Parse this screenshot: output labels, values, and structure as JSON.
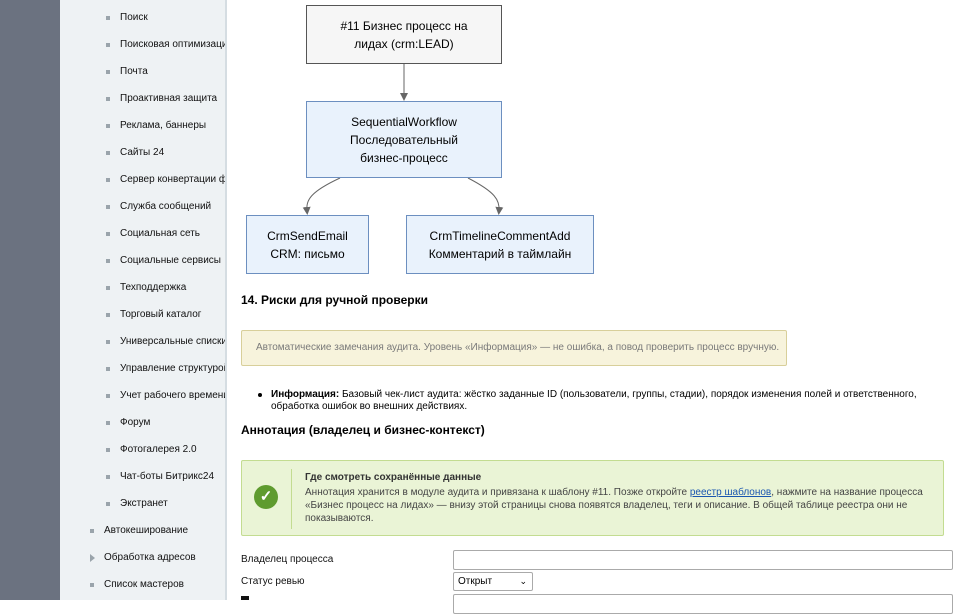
{
  "sidebar": {
    "items": [
      {
        "label": "Поиск"
      },
      {
        "label": "Поисковая оптимизаци"
      },
      {
        "label": "Почта"
      },
      {
        "label": "Проактивная защита"
      },
      {
        "label": "Реклама, баннеры"
      },
      {
        "label": "Сайты 24"
      },
      {
        "label": "Сервер конвертации ф"
      },
      {
        "label": "Служба сообщений"
      },
      {
        "label": "Социальная сеть"
      },
      {
        "label": "Социальные сервисы"
      },
      {
        "label": "Техподдержка"
      },
      {
        "label": "Торговый каталог"
      },
      {
        "label": "Универсальные списки"
      },
      {
        "label": "Управление структурой"
      },
      {
        "label": "Учет рабочего времени"
      },
      {
        "label": "Форум"
      },
      {
        "label": "Фотогалерея 2.0"
      },
      {
        "label": "Чат-боты Битрикс24"
      },
      {
        "label": "Экстранет"
      }
    ],
    "top_items": [
      {
        "label": "Автокеширование"
      },
      {
        "label": "Обработка адресов"
      },
      {
        "label": "Список мастеров"
      }
    ]
  },
  "diagram": {
    "root": {
      "line1": "#11 Бизнес процесс на",
      "line2": "лидах (crm:LEAD)"
    },
    "workflow": {
      "line1": "SequentialWorkflow",
      "line2": "Последовательный",
      "line3": "бизнес-процесс"
    },
    "email": {
      "line1": "CrmSendEmail",
      "line2": "CRM: письмо"
    },
    "comment": {
      "line1": "CrmTimelineCommentAdd",
      "line2": "Комментарий в таймлайн"
    }
  },
  "risks": {
    "heading": "14. Риски для ручной проверки",
    "warning": "Автоматические замечания аудита. Уровень «Информация» — не ошибка, а повод проверить процесс вручную.",
    "info_label": "Информация:",
    "info_text": " Базовый чек-лист аудита: жёстко заданные ID (пользователи, группы, стадии), порядок изменения полей и ответственного, обработка ошибок во внешних действиях."
  },
  "annotation": {
    "heading": "Аннотация (владелец и бизнес-контекст)",
    "box_title": "Где смотреть сохранённые данные",
    "box_text_before": "Аннотация хранится в модуле аудита и привязана к шаблону #11. Позже откройте ",
    "box_link": "реестр шаблонов",
    "box_text_after": ", нажмите на название процесса «Бизнес процесс на лидах» — внизу этой страницы снова появятся владелец, теги и описание. В общей таблице реестра они не показываются.",
    "icon": "check-icon"
  },
  "form": {
    "owner_label": "Владелец процесса",
    "owner_value": "",
    "status_label": "Статус ревью",
    "status_value": "Открыт"
  }
}
